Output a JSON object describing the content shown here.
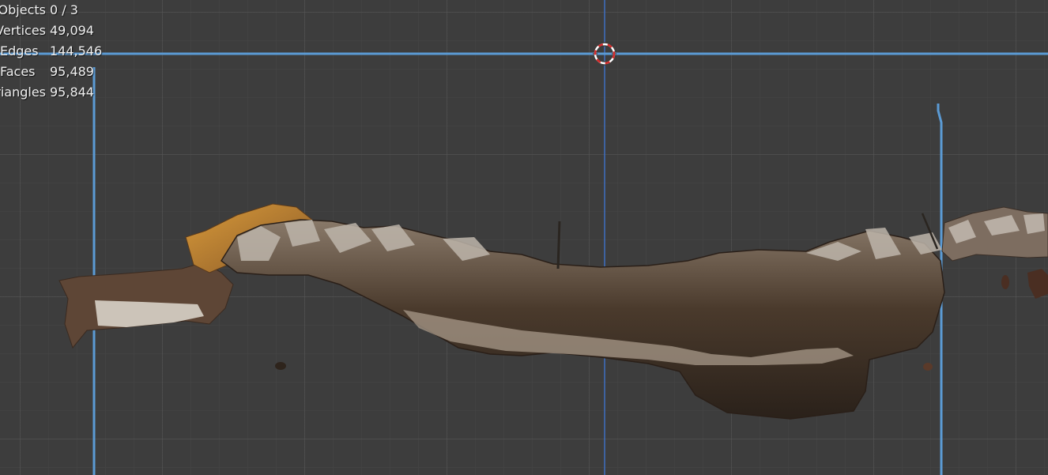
{
  "stats": {
    "rows": [
      {
        "label": "Objects",
        "value": "0 / 3"
      },
      {
        "label": "Vertices",
        "value": "49,094"
      },
      {
        "label": "Edges",
        "value": "144,546"
      },
      {
        "label": "Faces",
        "value": "95,489"
      },
      {
        "label": "Triangles",
        "value": "95,844"
      }
    ]
  },
  "viewport": {
    "background_color": "#3d3d3d",
    "grid": true,
    "outline_color": "#5b9bd5",
    "axis_color": "#3f6fc2",
    "mesh": "scanned-rock-mesh"
  },
  "cursor": {
    "icon": "3d-cursor-icon"
  }
}
